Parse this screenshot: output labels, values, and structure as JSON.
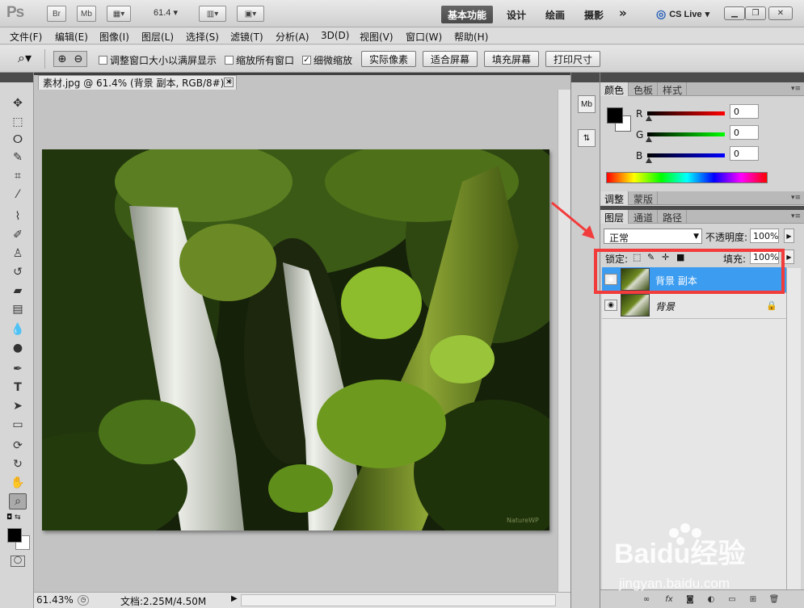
{
  "titlebar": {
    "app_logo": "Ps",
    "bridge_label": "Br",
    "minibridge_label": "Mb",
    "zoom_value": "61.4",
    "workspaces": [
      "基本功能",
      "设计",
      "绘画",
      "摄影"
    ],
    "more_label": "»",
    "cs_live_label": "CS Live",
    "icons": [
      "film-icon",
      "arrange-icon",
      "screen-mode-icon",
      "minimize-icon",
      "restore-icon",
      "close-icon"
    ]
  },
  "menubar": {
    "items": [
      "文件(F)",
      "编辑(E)",
      "图像(I)",
      "图层(L)",
      "选择(S)",
      "滤镜(T)",
      "分析(A)",
      "3D(D)",
      "视图(V)",
      "窗口(W)",
      "帮助(H)"
    ]
  },
  "options": {
    "checkboxes": [
      {
        "label": "调整窗口大小以满屏显示",
        "checked": false
      },
      {
        "label": "缩放所有窗口",
        "checked": false
      },
      {
        "label": "细微缩放",
        "checked": true
      }
    ],
    "buttons": [
      "实际像素",
      "适合屏幕",
      "填充屏幕",
      "打印尺寸"
    ]
  },
  "document": {
    "tab_title": "素材.jpg @ 61.4% (背景 副本, RGB/8#) *",
    "close_label": "×",
    "status_zoom": "61.43%",
    "status_doc": "文档:2.25M/4.50M",
    "watermark_text": "NatureWP"
  },
  "color_panel": {
    "tabs": [
      "颜色",
      "色板",
      "样式"
    ],
    "channels": [
      {
        "label": "R",
        "value": "0",
        "color": "#cc0000"
      },
      {
        "label": "G",
        "value": "0",
        "color": "#00cc00"
      },
      {
        "label": "B",
        "value": "0",
        "color": "#0000cc"
      }
    ]
  },
  "adjust_panel": {
    "tabs": [
      "调整",
      "蒙版"
    ]
  },
  "layers_panel": {
    "tabs": [
      "图层",
      "通道",
      "路径"
    ],
    "blend_mode": "正常",
    "opacity_label": "不透明度:",
    "opacity_value": "100%",
    "lock_label": "锁定:",
    "fill_label": "填充:",
    "fill_value": "100%",
    "layers": [
      {
        "name": "背景 副本",
        "selected": true,
        "locked": false
      },
      {
        "name": "背景",
        "selected": false,
        "locked": true
      }
    ]
  },
  "colors": {
    "selected_layer": "#3c9cf0",
    "annotation": "#f23b3b"
  },
  "watermark": {
    "brand": "Baidu经验",
    "url": "jingyan.baidu.com"
  }
}
